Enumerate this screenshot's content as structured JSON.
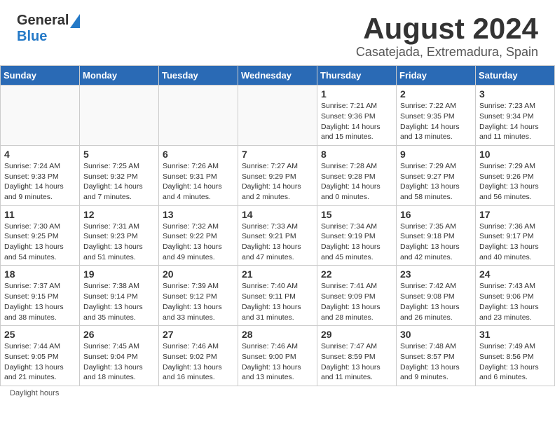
{
  "header": {
    "logo_general": "General",
    "logo_blue": "Blue",
    "title": "August 2024",
    "location": "Casatejada, Extremadura, Spain"
  },
  "weekdays": [
    "Sunday",
    "Monday",
    "Tuesday",
    "Wednesday",
    "Thursday",
    "Friday",
    "Saturday"
  ],
  "footer": {
    "daylight_hours": "Daylight hours"
  },
  "weeks": [
    [
      {
        "num": "",
        "detail": ""
      },
      {
        "num": "",
        "detail": ""
      },
      {
        "num": "",
        "detail": ""
      },
      {
        "num": "",
        "detail": ""
      },
      {
        "num": "1",
        "detail": "Sunrise: 7:21 AM\nSunset: 9:36 PM\nDaylight: 14 hours\nand 15 minutes."
      },
      {
        "num": "2",
        "detail": "Sunrise: 7:22 AM\nSunset: 9:35 PM\nDaylight: 14 hours\nand 13 minutes."
      },
      {
        "num": "3",
        "detail": "Sunrise: 7:23 AM\nSunset: 9:34 PM\nDaylight: 14 hours\nand 11 minutes."
      }
    ],
    [
      {
        "num": "4",
        "detail": "Sunrise: 7:24 AM\nSunset: 9:33 PM\nDaylight: 14 hours\nand 9 minutes."
      },
      {
        "num": "5",
        "detail": "Sunrise: 7:25 AM\nSunset: 9:32 PM\nDaylight: 14 hours\nand 7 minutes."
      },
      {
        "num": "6",
        "detail": "Sunrise: 7:26 AM\nSunset: 9:31 PM\nDaylight: 14 hours\nand 4 minutes."
      },
      {
        "num": "7",
        "detail": "Sunrise: 7:27 AM\nSunset: 9:29 PM\nDaylight: 14 hours\nand 2 minutes."
      },
      {
        "num": "8",
        "detail": "Sunrise: 7:28 AM\nSunset: 9:28 PM\nDaylight: 14 hours\nand 0 minutes."
      },
      {
        "num": "9",
        "detail": "Sunrise: 7:29 AM\nSunset: 9:27 PM\nDaylight: 13 hours\nand 58 minutes."
      },
      {
        "num": "10",
        "detail": "Sunrise: 7:29 AM\nSunset: 9:26 PM\nDaylight: 13 hours\nand 56 minutes."
      }
    ],
    [
      {
        "num": "11",
        "detail": "Sunrise: 7:30 AM\nSunset: 9:25 PM\nDaylight: 13 hours\nand 54 minutes."
      },
      {
        "num": "12",
        "detail": "Sunrise: 7:31 AM\nSunset: 9:23 PM\nDaylight: 13 hours\nand 51 minutes."
      },
      {
        "num": "13",
        "detail": "Sunrise: 7:32 AM\nSunset: 9:22 PM\nDaylight: 13 hours\nand 49 minutes."
      },
      {
        "num": "14",
        "detail": "Sunrise: 7:33 AM\nSunset: 9:21 PM\nDaylight: 13 hours\nand 47 minutes."
      },
      {
        "num": "15",
        "detail": "Sunrise: 7:34 AM\nSunset: 9:19 PM\nDaylight: 13 hours\nand 45 minutes."
      },
      {
        "num": "16",
        "detail": "Sunrise: 7:35 AM\nSunset: 9:18 PM\nDaylight: 13 hours\nand 42 minutes."
      },
      {
        "num": "17",
        "detail": "Sunrise: 7:36 AM\nSunset: 9:17 PM\nDaylight: 13 hours\nand 40 minutes."
      }
    ],
    [
      {
        "num": "18",
        "detail": "Sunrise: 7:37 AM\nSunset: 9:15 PM\nDaylight: 13 hours\nand 38 minutes."
      },
      {
        "num": "19",
        "detail": "Sunrise: 7:38 AM\nSunset: 9:14 PM\nDaylight: 13 hours\nand 35 minutes."
      },
      {
        "num": "20",
        "detail": "Sunrise: 7:39 AM\nSunset: 9:12 PM\nDaylight: 13 hours\nand 33 minutes."
      },
      {
        "num": "21",
        "detail": "Sunrise: 7:40 AM\nSunset: 9:11 PM\nDaylight: 13 hours\nand 31 minutes."
      },
      {
        "num": "22",
        "detail": "Sunrise: 7:41 AM\nSunset: 9:09 PM\nDaylight: 13 hours\nand 28 minutes."
      },
      {
        "num": "23",
        "detail": "Sunrise: 7:42 AM\nSunset: 9:08 PM\nDaylight: 13 hours\nand 26 minutes."
      },
      {
        "num": "24",
        "detail": "Sunrise: 7:43 AM\nSunset: 9:06 PM\nDaylight: 13 hours\nand 23 minutes."
      }
    ],
    [
      {
        "num": "25",
        "detail": "Sunrise: 7:44 AM\nSunset: 9:05 PM\nDaylight: 13 hours\nand 21 minutes."
      },
      {
        "num": "26",
        "detail": "Sunrise: 7:45 AM\nSunset: 9:04 PM\nDaylight: 13 hours\nand 18 minutes."
      },
      {
        "num": "27",
        "detail": "Sunrise: 7:46 AM\nSunset: 9:02 PM\nDaylight: 13 hours\nand 16 minutes."
      },
      {
        "num": "28",
        "detail": "Sunrise: 7:46 AM\nSunset: 9:00 PM\nDaylight: 13 hours\nand 13 minutes."
      },
      {
        "num": "29",
        "detail": "Sunrise: 7:47 AM\nSunset: 8:59 PM\nDaylight: 13 hours\nand 11 minutes."
      },
      {
        "num": "30",
        "detail": "Sunrise: 7:48 AM\nSunset: 8:57 PM\nDaylight: 13 hours\nand 9 minutes."
      },
      {
        "num": "31",
        "detail": "Sunrise: 7:49 AM\nSunset: 8:56 PM\nDaylight: 13 hours\nand 6 minutes."
      }
    ]
  ]
}
